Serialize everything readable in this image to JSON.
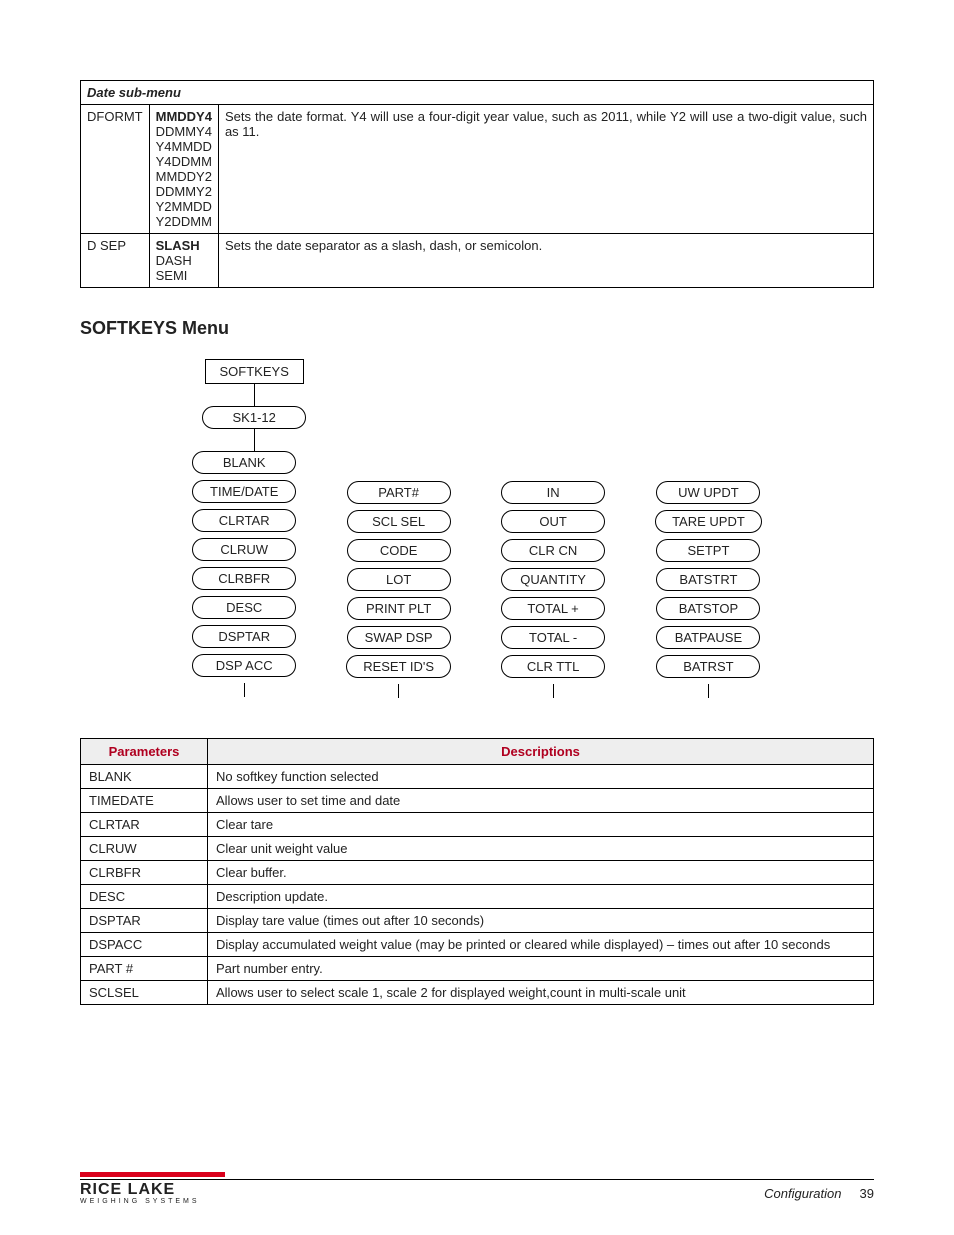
{
  "table1": {
    "section": "Date sub-menu",
    "rows": [
      {
        "param": "DFORMT",
        "opts": [
          "MMDDY4",
          "DDMMY4",
          "Y4MMDD",
          "Y4DDMM",
          "MMDDY2",
          "DDMMY2",
          "Y2MMDD",
          "Y2DDMM"
        ],
        "opts_bold": [
          true,
          false,
          false,
          false,
          false,
          false,
          false,
          false
        ],
        "desc": "Sets the date format. Y4 will use a four-digit year value, such as 2011, while Y2 will use a two-digit value, such as 11."
      },
      {
        "param": "D SEP",
        "opts": [
          "SLASH",
          "DASH",
          "SEMI"
        ],
        "opts_bold": [
          true,
          false,
          false
        ],
        "desc": "Sets the date separator as a slash, dash, or semicolon."
      }
    ]
  },
  "section_heading": "SOFTKEYS Menu",
  "diagram": {
    "root": "SOFTKEYS",
    "child": "SK1-12",
    "columns": [
      [
        "BLANK",
        "TIME/DATE",
        "CLRTAR",
        "CLRUW",
        "CLRBFR",
        "DESC",
        "DSPTAR",
        "DSP ACC"
      ],
      [
        "PART#",
        "SCL SEL",
        "CODE",
        "LOT",
        "PRINT PLT",
        "SWAP DSP",
        "RESET ID'S"
      ],
      [
        "IN",
        "OUT",
        "CLR CN",
        "QUANTITY",
        "TOTAL +",
        "TOTAL -",
        "CLR TTL"
      ],
      [
        "UW UPDT",
        "TARE UPDT",
        "SETPT",
        "BATSTRT",
        "BATSTOP",
        "BATPAUSE",
        "BATRST"
      ]
    ]
  },
  "table2": {
    "headers": [
      "Parameters",
      "Descriptions"
    ],
    "rows": [
      [
        "BLANK",
        "No softkey function selected"
      ],
      [
        "TIMEDATE",
        "Allows user to set time and date"
      ],
      [
        "CLRTAR",
        "Clear tare"
      ],
      [
        "CLRUW",
        "Clear unit weight value"
      ],
      [
        "CLRBFR",
        "Clear buffer."
      ],
      [
        "DESC",
        "Description update."
      ],
      [
        "DSPTAR",
        "Display tare value (times out after 10 seconds)"
      ],
      [
        "DSPACC",
        "Display accumulated weight value (may be printed or cleared while displayed) – times out after 10 seconds"
      ],
      [
        "PART #",
        "Part number entry."
      ],
      [
        "SCLSEL",
        "Allows user to select scale 1, scale 2 for displayed weight,count in multi-scale unit"
      ]
    ]
  },
  "footer": {
    "logo_main": "RICE LAKE",
    "logo_sub": "WEIGHING SYSTEMS",
    "label": "Configuration",
    "page": "39"
  }
}
